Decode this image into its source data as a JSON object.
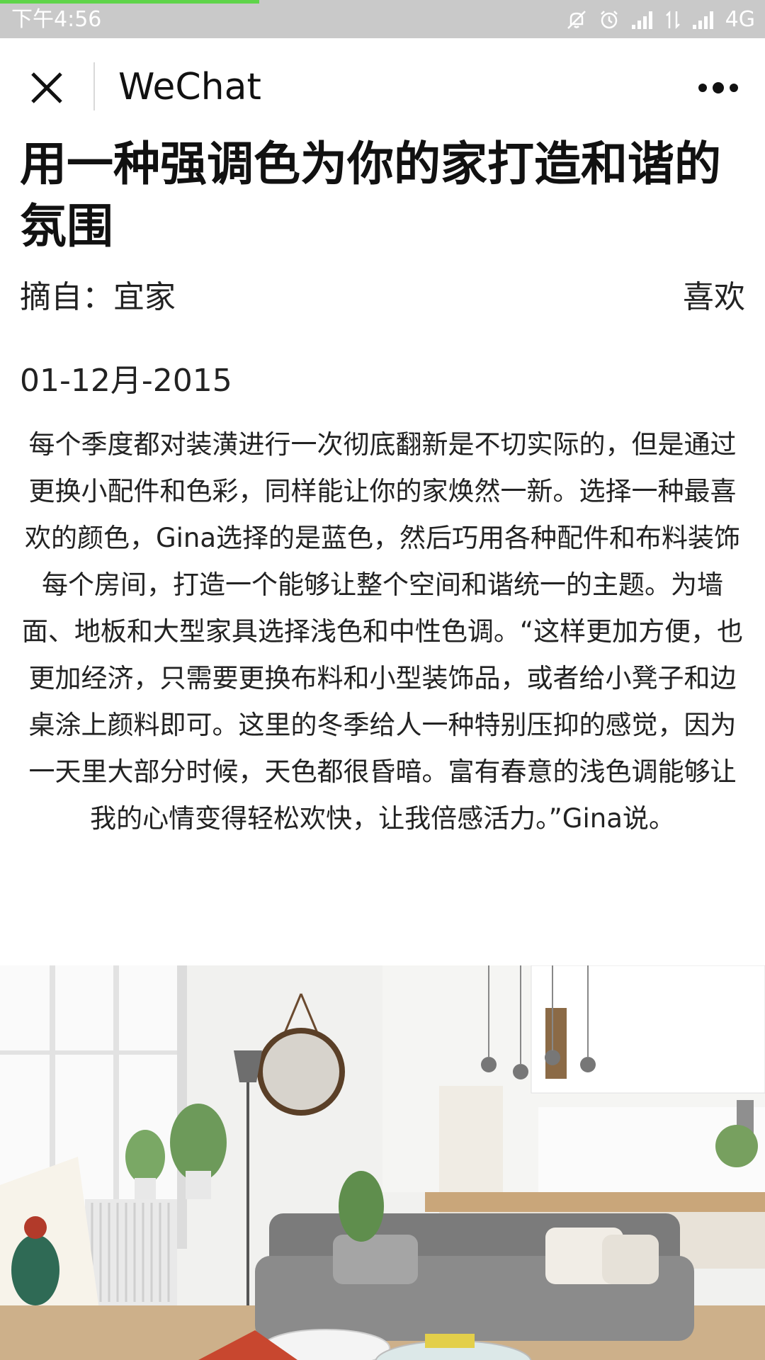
{
  "status_bar": {
    "time": "下午4:56",
    "network": "4G",
    "icons": [
      "mute-icon",
      "alarm-icon",
      "signal-icon",
      "data-transfer-icon",
      "signal-icon"
    ],
    "progress_color": "#5fd44a"
  },
  "nav": {
    "close_icon": "close-icon",
    "title": "WeChat",
    "more_icon": "more-dots-icon"
  },
  "article": {
    "title": "用一种强调色为你的家打造和谐的氛围",
    "source_label": "摘自：",
    "source_name": "宜家",
    "like_label": "喜欢",
    "date": "01-12月-2015",
    "body": "每个季度都对装潢进行一次彻底翻新是不切实际的，但是通过更换小配件和色彩，同样能让你的家焕然一新。选择一种最喜欢的颜色，Gina选择的是蓝色，然后巧用各种配件和布料装饰每个房间，打造一个能够让整个空间和谐统一的主题。为墙面、地板和大型家具选择浅色和中性色调。“这样更加方便，也更加经济，只需要更换布料和小型装饰品，或者给小凳子和边桌涂上颜料即可。这里的冬季给人一种特别压抑的感觉，因为一天里大部分时候，天色都很昏暗。富有春意的浅色调能够让我的心情变得轻松欢快，让我倍感活力。”Gina说。"
  },
  "image": {
    "subject": "living-room-photo"
  }
}
